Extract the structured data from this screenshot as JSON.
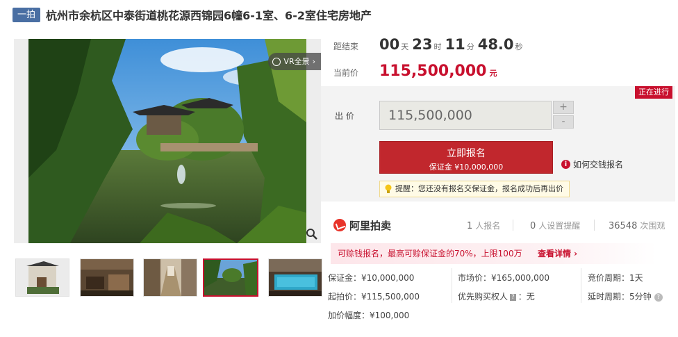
{
  "header": {
    "badge": "一拍",
    "title": "杭州市余杭区中泰街道桃花源西锦园6幢6-1室、6-2室住宅房地产"
  },
  "gallery": {
    "vr_label": "VR全景",
    "thumbnails": [
      "thumb-villa-exterior",
      "thumb-interior-room",
      "thumb-hallway",
      "thumb-garden-pond",
      "thumb-indoor-pool"
    ],
    "active_index": 3
  },
  "countdown": {
    "label": "距结束",
    "days": "00",
    "days_unit": "天",
    "hours": "23",
    "hours_unit": "时",
    "minutes": "11",
    "minutes_unit": "分",
    "seconds": "48.0",
    "seconds_unit": "秒"
  },
  "current_price": {
    "label": "当前价",
    "value": "115,500,000",
    "unit": "元"
  },
  "bid": {
    "status": "正在进行",
    "label": "出 价",
    "value": "115,500,000",
    "plus": "+",
    "minus": "-",
    "signup_label": "立即报名",
    "signup_sub": "保证金 ¥10,000,000",
    "howto": "如何交钱报名",
    "reminder": "提醒：您还没有报名交保证金，报名成功后再出价"
  },
  "stats": {
    "brand": "阿里拍卖",
    "signups_num": "1",
    "signups_label": "人报名",
    "reminders_num": "0",
    "reminders_label": "人设置提醒",
    "views_num": "36548",
    "views_label": "次围观"
  },
  "promo": {
    "text": "可赊钱报名，最高可赊保证金的70%，上限100万",
    "detail": "查看详情 ›"
  },
  "info": {
    "deposit": "保证金：¥10,000,000",
    "starting_price": "起拍价：¥115,500,000",
    "increment": "加价幅度：¥100,000",
    "market_price": "市场价：¥165,000,000",
    "priority_buyer_key": "优先购买权人",
    "priority_buyer_tag": "?",
    "priority_buyer_val": "：无",
    "auction_period": "竞价周期：1天",
    "extension": "延时周期：5分钟"
  },
  "colors": {
    "accent_red": "#c8102e",
    "badge_blue": "#4a6fa3",
    "panel_gray": "#f3f3f3"
  }
}
